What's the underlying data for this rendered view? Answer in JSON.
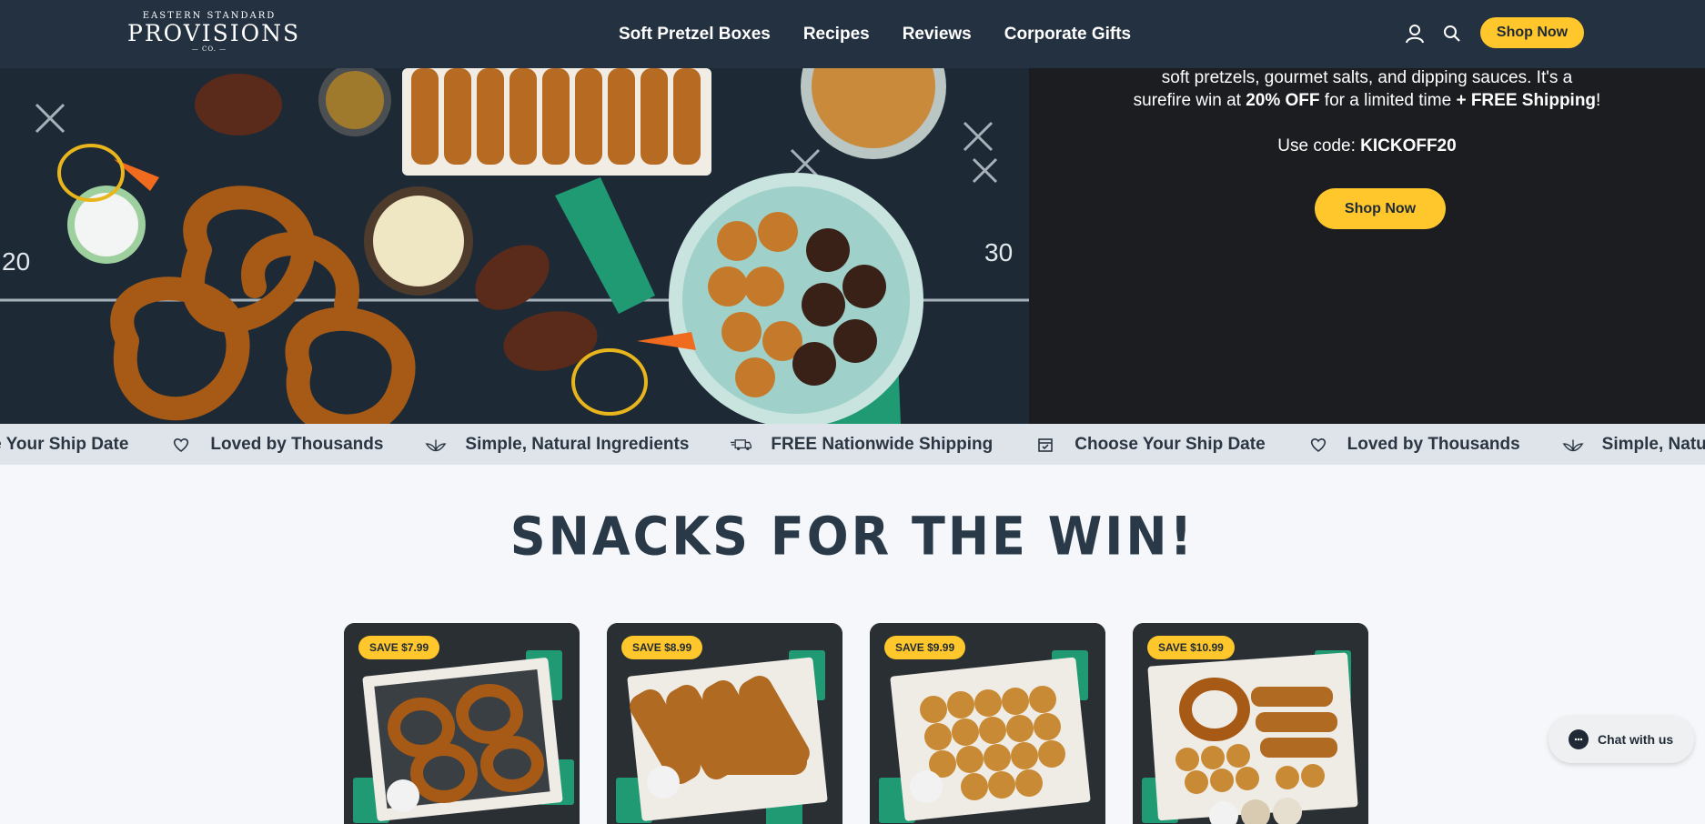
{
  "header": {
    "logo_top": "EASTERN STANDARD",
    "logo_main": "PROVISIONS",
    "logo_co": "— CO. —",
    "nav": [
      "Soft Pretzel Boxes",
      "Recipes",
      "Reviews",
      "Corporate Gifts"
    ],
    "shop_now": "Shop Now",
    "icons": [
      "user-icon",
      "search-icon"
    ]
  },
  "hero": {
    "promo_line1": "soft pretzels, gourmet salts, and dipping sauces. It's a",
    "promo_line2_pre": "surefire win at ",
    "promo_line2_bold1": "20% OFF",
    "promo_line2_mid": " for a limited time ",
    "promo_line2_bold2": "+ FREE Shipping",
    "promo_line2_end": "!",
    "code_label": "Use code: ",
    "code": "KICKOFF20",
    "shop_now": "Shop Now",
    "image_yard_left": "20",
    "image_yard_right": "30"
  },
  "ticker": {
    "items": [
      {
        "icon": "calendar-icon",
        "label": "Choose Your Ship Date"
      },
      {
        "icon": "heart-icon",
        "label": "Loved by Thousands"
      },
      {
        "icon": "leaf-icon",
        "label": "Simple, Natural Ingredients"
      },
      {
        "icon": "truck-icon",
        "label": "FREE Nationwide Shipping"
      },
      {
        "icon": "calendar-icon",
        "label": "Choose Your Ship Date"
      },
      {
        "icon": "heart-icon",
        "label": "Loved by Thousands"
      },
      {
        "icon": "leaf-icon",
        "label": "Simple, Natural Ingredients"
      }
    ]
  },
  "section": {
    "title": "SNACKS FOR THE WIN!"
  },
  "cards": [
    {
      "badge": "SAVE $7.99"
    },
    {
      "badge": "SAVE $8.99"
    },
    {
      "badge": "SAVE $9.99"
    },
    {
      "badge": "SAVE $10.99"
    }
  ],
  "chat": {
    "label": "Chat with us"
  },
  "colors": {
    "header_bg": "#243140",
    "accent": "#ffc72c",
    "hero_dark": "#1c1d21",
    "ticker_bg": "#dfe4ea"
  }
}
